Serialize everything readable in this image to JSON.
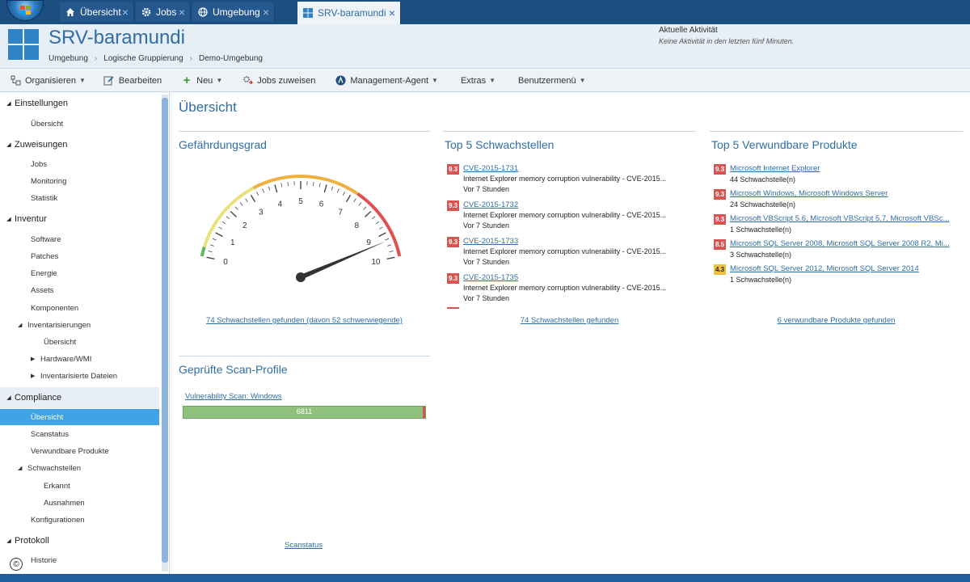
{
  "tabs": [
    {
      "label": "Übersicht",
      "icon": "home-icon"
    },
    {
      "label": "Jobs",
      "icon": "gear-icon"
    },
    {
      "label": "Umgebung",
      "icon": "globe-icon"
    },
    {
      "label": "SRV-baramundi",
      "icon": "windows-logo-icon"
    }
  ],
  "header": {
    "title": "SRV-baramundi",
    "breadcrumb": [
      "Umgebung",
      "Logische Gruppierung",
      "Demo-Umgebung"
    ],
    "activity_title": "Aktuelle Aktivität",
    "activity_text": "Keine Aktivität in den letzten fünf Minuten."
  },
  "toolbar": {
    "organize": "Organisieren",
    "edit": "Bearbeiten",
    "new": "Neu",
    "assign_jobs": "Jobs zuweisen",
    "management_agent": "Management-Agent",
    "extras": "Extras",
    "user_menu": "Benutzermenü"
  },
  "sidebar": {
    "settings": {
      "label": "Einstellungen",
      "items": [
        "Übersicht"
      ]
    },
    "assignments": {
      "label": "Zuweisungen",
      "items": [
        "Jobs",
        "Monitoring",
        "Statistik"
      ]
    },
    "inventory": {
      "label": "Inventur",
      "items": [
        "Software",
        "Patches",
        "Energie",
        "Assets",
        "Komponenten"
      ],
      "inventarisierungen": "Inventarisierungen",
      "inv_items": [
        "Übersicht",
        "Hardware/WMI",
        "Inventarisierte Dateien"
      ]
    },
    "compliance": {
      "label": "Compliance",
      "items": [
        "Übersicht",
        "Scanstatus",
        "Verwundbare Produkte"
      ],
      "schwachstellen": "Schwachstellen",
      "schw_items": [
        "Erkannt",
        "Ausnahmen"
      ],
      "konfigurationen": "Konfigurationen"
    },
    "protocol": {
      "label": "Protokoll",
      "items": [
        "Historie"
      ]
    }
  },
  "main": {
    "page_title": "Übersicht",
    "gauge": {
      "title": "Gefährdungsgrad",
      "ticks": [
        "0",
        "1",
        "2",
        "3",
        "4",
        "5",
        "6",
        "7",
        "8",
        "9",
        "10"
      ],
      "value": 9.3,
      "link": "74 Schwachstellen gefunden (davon 52 schwerwiegende)"
    },
    "top_vulns": {
      "title": "Top 5 Schwachstellen",
      "items": [
        {
          "score": "9.3",
          "id": "CVE-2015-1731",
          "desc": "Internet Explorer memory corruption vulnerability - CVE-2015...",
          "age": "Vor 7 Stunden"
        },
        {
          "score": "9.3",
          "id": "CVE-2015-1732",
          "desc": "Internet Explorer memory corruption vulnerability - CVE-2015...",
          "age": "Vor 7 Stunden"
        },
        {
          "score": "9.3",
          "id": "CVE-2015-1733",
          "desc": "Internet Explorer memory corruption vulnerability - CVE-2015...",
          "age": "Vor 7 Stunden"
        },
        {
          "score": "9.3",
          "id": "CVE-2015-1735",
          "desc": "Internet Explorer memory corruption vulnerability - CVE-2015...",
          "age": "Vor 7 Stunden"
        }
      ],
      "link": "74 Schwachstellen gefunden"
    },
    "top_products": {
      "title": "Top 5 Verwundbare Produkte",
      "items": [
        {
          "score": "9.3",
          "name": "Microsoft Internet Explorer",
          "count": "44 Schwachstelle(n)"
        },
        {
          "score": "9.3",
          "name": "Microsoft Windows, Microsoft Windows Server",
          "count": "24 Schwachstelle(n)"
        },
        {
          "score": "9.3",
          "name": "Microsoft VBScript 5.6, Microsoft VBScript 5.7, Microsoft VBSc...",
          "count": "1 Schwachstelle(n)"
        },
        {
          "score": "8.5",
          "name": "Microsoft SQL Server 2008, Microsoft SQL Server 2008 R2, Mi...",
          "count": "3 Schwachstelle(n)"
        },
        {
          "score": "4.3",
          "name": "Microsoft SQL Server 2012, Microsoft SQL Server 2014",
          "count": "1 Schwachstelle(n)"
        }
      ],
      "link": "6 verwundbare Produkte gefunden"
    },
    "scan_profiles": {
      "title": "Geprüfte Scan-Profile",
      "profile": "Vulnerability Scan: Windows",
      "value": "6811",
      "link": "Scanstatus"
    }
  },
  "colors": {
    "accent": "#2f6da6",
    "severity_high": "#d9534f",
    "severity_medium": "#f0c040",
    "selection": "#3fa3e6"
  }
}
